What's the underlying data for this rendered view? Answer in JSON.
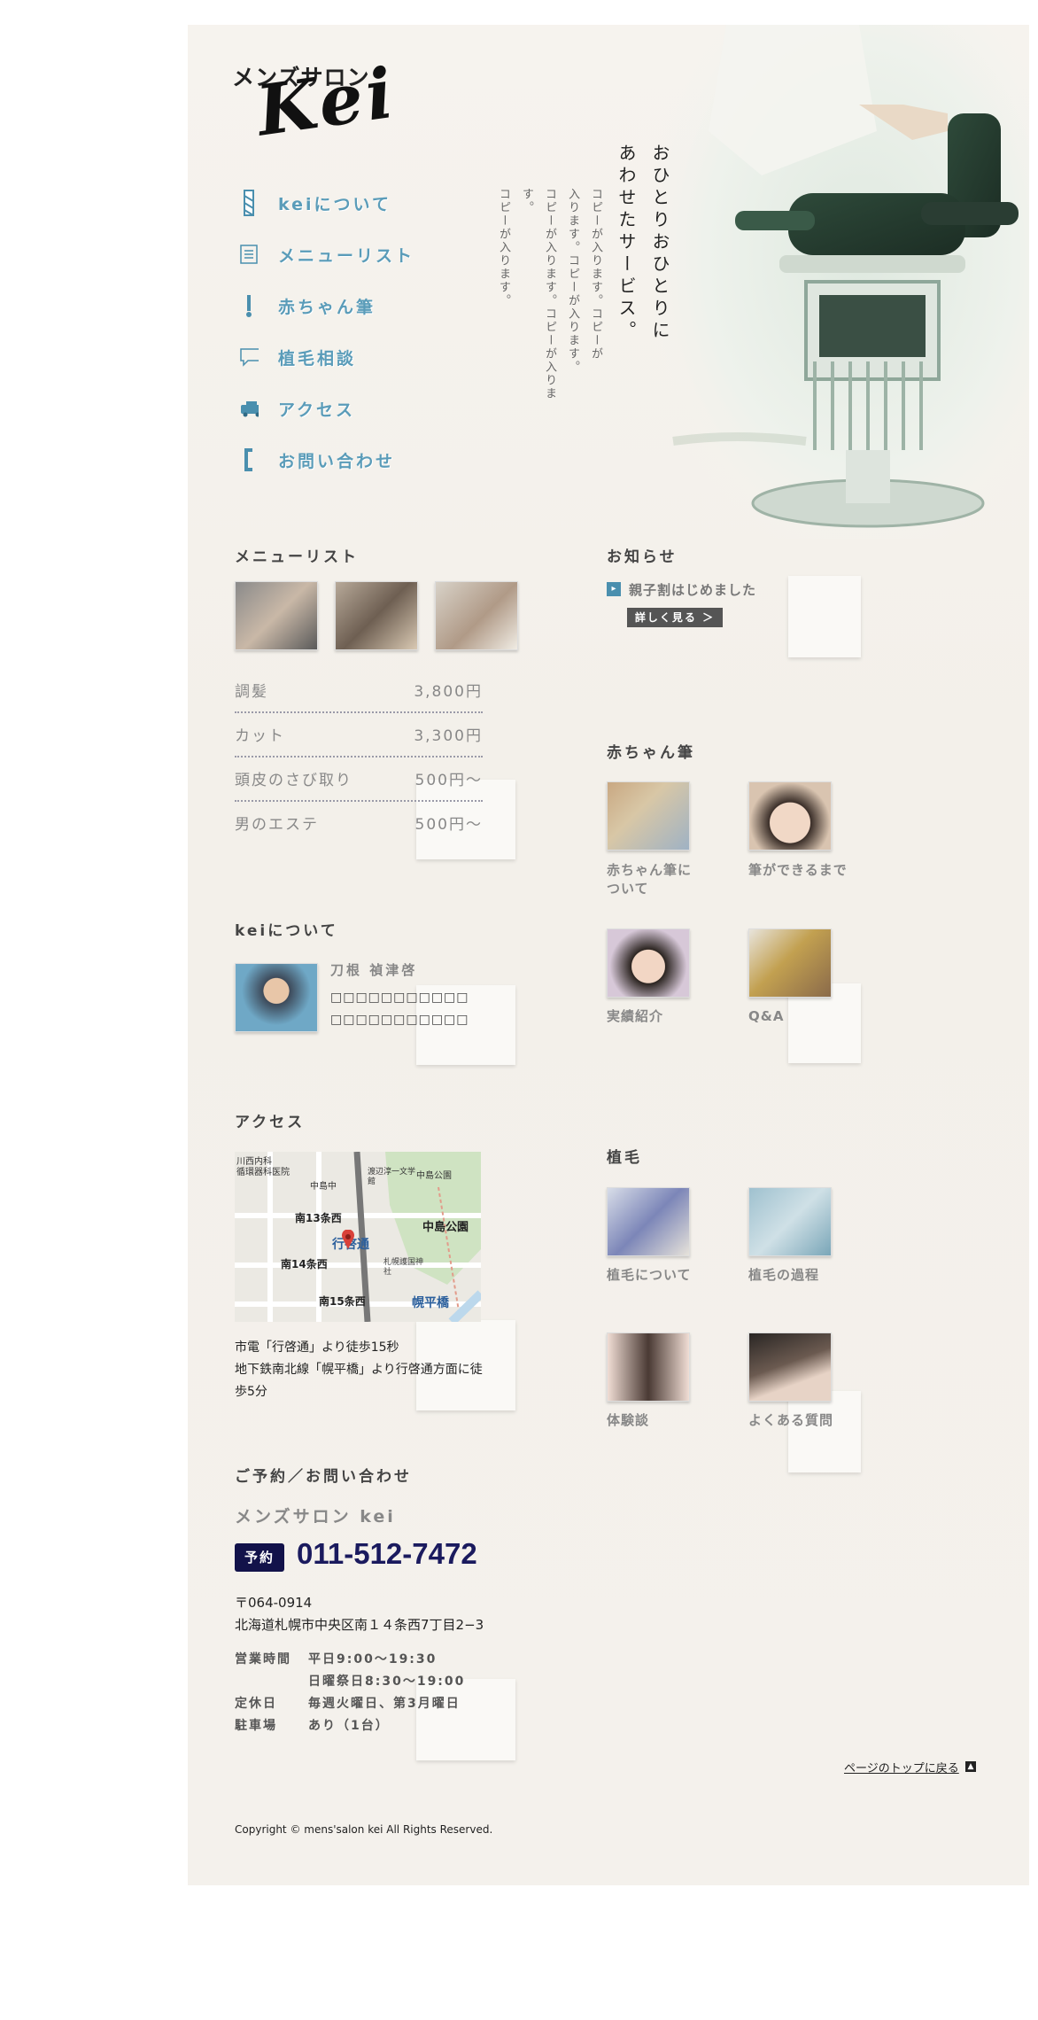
{
  "logo": {
    "small": "メンズサロン",
    "big": "Kei"
  },
  "nav": [
    {
      "label": "keiについて",
      "icon": "barber-pole-icon"
    },
    {
      "label": "メニューリスト",
      "icon": "list-icon"
    },
    {
      "label": "赤ちゃん筆",
      "icon": "brush-icon"
    },
    {
      "label": "植毛相談",
      "icon": "speech-bubble-icon"
    },
    {
      "label": "アクセス",
      "icon": "car-icon"
    },
    {
      "label": "お問い合わせ",
      "icon": "bracket-icon"
    }
  ],
  "hero": {
    "tagline": [
      "おひとりおひとりに",
      "あわせたサービス。"
    ],
    "copy": [
      "コピーが入ります。コピーが",
      "入ります。コピーが入ります。",
      "コピーが入ります。コピーが入ります。",
      "コピーが入ります。"
    ]
  },
  "menu": {
    "title": "メニューリスト",
    "items": [
      {
        "name": "調髪",
        "price": "3,800円"
      },
      {
        "name": "カット",
        "price": "3,300円"
      },
      {
        "name": "頭皮のさび取り",
        "price": "500円〜"
      },
      {
        "name": "男のエステ",
        "price": "500円〜"
      }
    ]
  },
  "news": {
    "title": "お知らせ",
    "item": "親子割はじめました",
    "more": "詳しく見る ＞"
  },
  "baby": {
    "title": "赤ちゃん筆",
    "items": [
      "赤ちゃん筆について",
      "筆ができるまで",
      "実績紹介",
      "Q&A"
    ]
  },
  "about": {
    "title": "keiについて",
    "name": "刀根 禎津啓",
    "text1": "□□□□□□□□□□□",
    "text2": "□□□□□□□□□□□"
  },
  "access": {
    "title": "アクセス",
    "map_labels": [
      "川西内科",
      "循環器科医院",
      "中島中",
      "渡辺淳一文学館",
      "中島公園",
      "南13条西",
      "中島公園",
      "行啓通",
      "南14条西",
      "札幌護国神社",
      "南15条西",
      "幌平橋"
    ],
    "line1": "市電「行啓通」より徒歩15秒",
    "line2": "地下鉄南北線「幌平橋」より行啓通方面に徒歩5分"
  },
  "hair": {
    "title": "植毛",
    "items": [
      "植毛について",
      "植毛の過程",
      "体験談",
      "よくある質問"
    ]
  },
  "contact": {
    "title": "ご予約／お問い合わせ",
    "salon": "メンズサロン kei",
    "badge": "予約",
    "phone": "011-512-7472",
    "zip": "〒064-0914",
    "address": "北海道札幌市中央区南１４条西7丁目2−3",
    "hours_label": "営業時間",
    "hours1": "平日9:00〜19:30",
    "hours2": "日曜祭日8:30〜19:00",
    "holiday_label": "定休日",
    "holiday": "毎週火曜日、第3月曜日",
    "parking_label": "駐車場",
    "parking": "あり（1台）"
  },
  "pagetop": "ページのトップに戻る",
  "copyright": "Copyright © mens'salon kei All Rights Reserved.",
  "colors": {
    "accent": "#5a9cb9",
    "navy": "#1a1a5e",
    "badge": "#12124a"
  }
}
